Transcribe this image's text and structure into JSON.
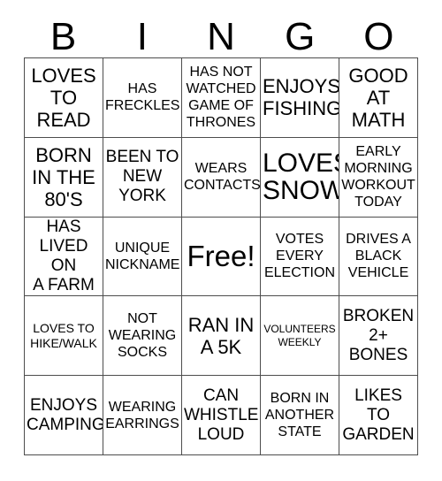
{
  "card": {
    "title": "BINGO",
    "header_letters": [
      "B",
      "I",
      "N",
      "G",
      "O"
    ],
    "rows": 5,
    "columns": 5,
    "colors": {
      "background": "#ffffff",
      "text": "#000000",
      "grid_line": "#4d4d4d"
    },
    "free_space": {
      "label": "Free!",
      "row": 3,
      "column": 3
    },
    "squares": [
      {
        "text": "LOVES\nTO\nREAD",
        "size": "xl"
      },
      {
        "text": "HAS\nFRECKLES",
        "size": "md"
      },
      {
        "text": "HAS NOT\nWATCHED\nGAME OF\nTHRONES",
        "size": "md"
      },
      {
        "text": "ENJOYS\nFISHING",
        "size": "xl"
      },
      {
        "text": "GOOD\nAT\nMATH",
        "size": "xl"
      },
      {
        "text": "BORN\nIN THE\n80'S",
        "size": "xl"
      },
      {
        "text": "BEEN TO\nNEW\nYORK",
        "size": "lg"
      },
      {
        "text": "WEARS\nCONTACTS",
        "size": "md"
      },
      {
        "text": "LOVES\nSNOW",
        "size": "xxl"
      },
      {
        "text": "EARLY\nMORNING\nWORKOUT\nTODAY",
        "size": "md"
      },
      {
        "text": "HAS\nLIVED ON\nA FARM",
        "size": "lg"
      },
      {
        "text": "UNIQUE\nNICKNAME",
        "size": "md"
      },
      {
        "text": "Free!",
        "size": "free"
      },
      {
        "text": "VOTES\nEVERY\nELECTION",
        "size": "md"
      },
      {
        "text": "DRIVES A\nBLACK\nVEHICLE",
        "size": "md"
      },
      {
        "text": "LOVES TO\nHIKE/WALK",
        "size": "sm"
      },
      {
        "text": "NOT\nWEARING\nSOCKS",
        "size": "md"
      },
      {
        "text": "RAN IN\nA 5K",
        "size": "xl"
      },
      {
        "text": "VOLUNTEERS\nWEEKLY",
        "size": "xs"
      },
      {
        "text": "BROKEN\n2+\nBONES",
        "size": "lg"
      },
      {
        "text": "ENJOYS\nCAMPING",
        "size": "lg"
      },
      {
        "text": "WEARING\nEARRINGS",
        "size": "md"
      },
      {
        "text": "CAN\nWHISTLE\nLOUD",
        "size": "lg"
      },
      {
        "text": "BORN IN\nANOTHER\nSTATE",
        "size": "md"
      },
      {
        "text": "LIKES\nTO\nGARDEN",
        "size": "lg"
      }
    ]
  }
}
